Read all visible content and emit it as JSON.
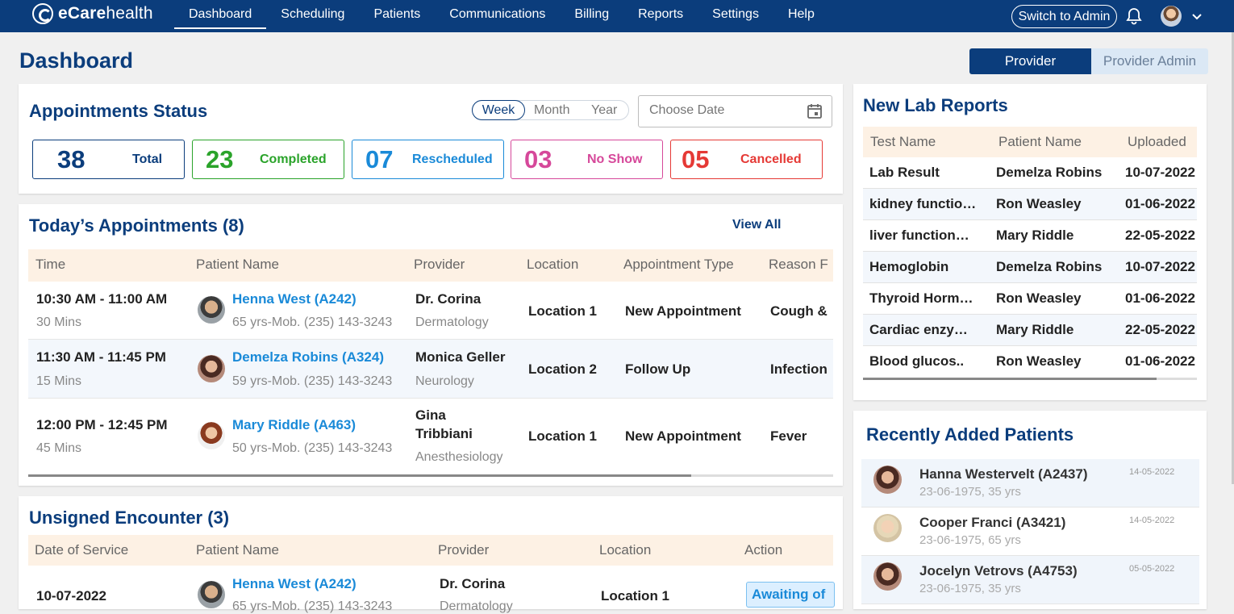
{
  "brand": {
    "name_bold": "eCare",
    "name_light": "health"
  },
  "nav": [
    "Dashboard",
    "Scheduling",
    "Patients",
    "Communications",
    "Billing",
    "Reports",
    "Settings",
    "Help"
  ],
  "header": {
    "switch_label": "Switch to Admin"
  },
  "page": {
    "title": "Dashboard",
    "role_provider": "Provider",
    "role_admin": "Provider Admin"
  },
  "appointments_status": {
    "title": "Appointments Status",
    "periods": [
      "Week",
      "Month",
      "Year"
    ],
    "date_placeholder": "Choose Date",
    "stats": [
      {
        "num": "38",
        "label": "Total",
        "color": "#0b3d7c"
      },
      {
        "num": "23",
        "label": "Completed",
        "color": "#2aa32a"
      },
      {
        "num": "07",
        "label": "Rescheduled",
        "color": "#1a8ad8"
      },
      {
        "num": "03",
        "label": "No Show",
        "color": "#d6489a"
      },
      {
        "num": "05",
        "label": "Cancelled",
        "color": "#e53935"
      }
    ]
  },
  "todays": {
    "title": "Today’s Appointments (8)",
    "view_all": "View All",
    "headers": [
      "Time",
      "Patient Name",
      "Provider",
      "Location",
      "Appointment Type",
      "Reason F"
    ],
    "rows": [
      {
        "time": "10:30 AM - 11:00 AM",
        "dur": "30 Mins",
        "patient": "Henna West (A242)",
        "info": "65 yrs-Mob. (235) 143-3243",
        "provider": "Dr. Corina",
        "dept": "Dermatology",
        "location": "Location 1",
        "type": "New Appointment",
        "reason": "Cough &"
      },
      {
        "time": "11:30 AM - 11:45 PM",
        "dur": "15 Mins",
        "patient": "Demelza Robins (A324)",
        "info": "59 yrs-Mob. (235) 143-3243",
        "provider": "Monica Geller",
        "dept": "Neurology",
        "location": "Location 2",
        "type": "Follow Up",
        "reason": "Infection"
      },
      {
        "time": "12:00 PM - 12:45 PM",
        "dur": "45 Mins",
        "patient": "Mary Riddle (A463)",
        "info": "50 yrs-Mob. (235) 143-3243",
        "provider_l1": "Gina",
        "provider_l2": "Tribbiani",
        "dept": "Anesthesiology",
        "location": "Location 1",
        "type": "New Appointment",
        "reason": "Fever"
      }
    ]
  },
  "unsigned": {
    "title": "Unsigned Encounter (3)",
    "headers": [
      "Date of Service",
      "Patient Name",
      "Provider",
      "Location",
      "Action"
    ],
    "row": {
      "date": "10-07-2022",
      "patient": "Henna West (A242)",
      "info": "65 yrs-Mob. (235) 143-3243",
      "provider": "Dr. Corina",
      "dept": "Dermatology",
      "location": "Location 1",
      "action": "Awaiting of"
    }
  },
  "lab": {
    "title": "New Lab Reports",
    "headers": [
      "Test Name",
      "Patient Name",
      "Uploaded"
    ],
    "rows": [
      [
        "Lab Result",
        "Demelza Robins",
        "10-07-2022"
      ],
      [
        "kidney functio…",
        "Ron Weasley",
        "01-06-2022"
      ],
      [
        "liver function…",
        "Mary Riddle",
        "22-05-2022"
      ],
      [
        "Hemoglobin",
        "Demelza Robins",
        "10-07-2022"
      ],
      [
        "Thyroid Horm…",
        "Ron Weasley",
        "01-06-2022"
      ],
      [
        "Cardiac enzy…",
        "Mary Riddle",
        "22-05-2022"
      ],
      [
        "Blood glucos..",
        "Ron Weasley",
        "01-06-2022"
      ]
    ]
  },
  "recent": {
    "title": "Recently Added Patients",
    "rows": [
      {
        "name": "Hanna Westervelt (A2437)",
        "dob": "23-06-1975, 35 yrs",
        "date": "14-05-2022"
      },
      {
        "name": "Cooper Franci (A3421)",
        "dob": "23-06-1975, 65 yrs",
        "date": "14-05-2022"
      },
      {
        "name": "Jocelyn Vetrovs (A4753)",
        "dob": "23-06-1975, 35 yrs",
        "date": "05-05-2022"
      }
    ]
  }
}
